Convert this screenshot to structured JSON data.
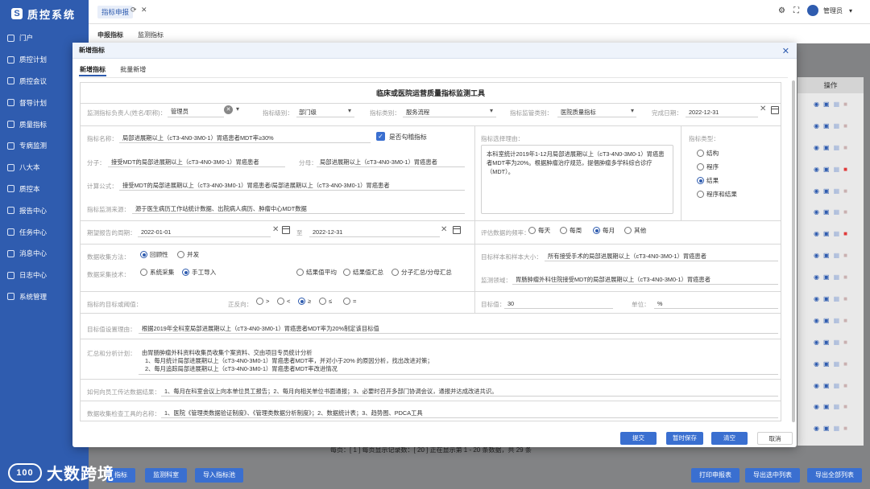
{
  "app": {
    "title": "质控系统"
  },
  "sidebar": {
    "items": [
      {
        "label": "门户"
      },
      {
        "label": "质控计划"
      },
      {
        "label": "质控会议"
      },
      {
        "label": "督导计划"
      },
      {
        "label": "质量指标"
      },
      {
        "label": "专病监测"
      },
      {
        "label": "八大本"
      },
      {
        "label": "质控本"
      },
      {
        "label": "报告中心"
      },
      {
        "label": "任务中心"
      },
      {
        "label": "消息中心"
      },
      {
        "label": "日志中心"
      },
      {
        "label": "系统管理"
      }
    ]
  },
  "header": {
    "tab_label": "指标申报",
    "user_name": "管理员",
    "icons": [
      "refresh-icon",
      "close-icon",
      "settings-icon",
      "fullscreen-icon",
      "avatar-icon",
      "caret-down-icon"
    ]
  },
  "subtabs": {
    "items": [
      {
        "label": "申报指标"
      },
      {
        "label": "监测指标"
      }
    ]
  },
  "background_table": {
    "action_header": "操作",
    "row_count": 16
  },
  "pagination": {
    "text": "每页：[ 1 ] 每页显示记录数：[ 20 ] 正在显示第 1 - 20 条数据，共 29 条"
  },
  "bottom_buttons": {
    "left": [
      "指标",
      "监测科室",
      "导入指标池"
    ],
    "right": [
      "打印申报表",
      "导出选中列表",
      "导出全部列表"
    ]
  },
  "watermark": {
    "text": "大数跨境"
  },
  "modal": {
    "title": "新增指标",
    "tabs": [
      {
        "label": "新增指标"
      },
      {
        "label": "批量新增"
      }
    ],
    "form_title": "临床或医院运营质量指标监测工具",
    "row1": {
      "owner_label": "监测指标负责人(姓名/职称)：",
      "owner_value": "管理员",
      "level_label": "指标级别：",
      "level_value": "部门级",
      "category_label": "指标类别：",
      "category_value": "服务流程",
      "supervise_label": "指标监管类别：",
      "supervise_value": "医院质量指标",
      "date_label": "完成日期：",
      "date_value": "2022-12-31"
    },
    "row2": {
      "name_label": "指标名称：",
      "name_value": "局部进展期以上（cT3-4N0-3M0-1）胃癌患者MDT率≥30%",
      "key_check_label": "是否勾稽指标",
      "reason_label": "指标选择理由：",
      "reason_text": "本科室统计2019年1-12月局部进展期以上（cT3-4N0-3M0-1）胃癌患者MDT率为20%。根据肿瘤治疗规范，提倡肿瘤多学科综合诊疗（MDT）。",
      "type_label": "指标类型：",
      "type_options": [
        {
          "label": "结构",
          "checked": false
        },
        {
          "label": "程序",
          "checked": false
        },
        {
          "label": "结果",
          "checked": true
        },
        {
          "label": "程序和结果",
          "checked": false
        }
      ],
      "numerator_label": "分子：",
      "numerator_value": "接受MDT的局部进展期以上（cT3-4N0-3M0-1）胃癌患者",
      "denominator_label": "分母：",
      "denominator_value": "局部进展期以上（cT3-4N0-3M0-1）胃癌患者",
      "formula_label": "计算公式：",
      "formula_value": "接受MDT的局部进展期以上（cT3-4N0-3M0-1）胃癌患者/局部进展期以上（cT3-4N0-3M0-1）胃癌患者",
      "source_label": "指标监测来源：",
      "source_value": "源于医生病历工作站统计数据、出院病人病历、肿瘤中心MDT数据"
    },
    "row3": {
      "period_label": "期望报告的周期：",
      "start_value": "2022-01-01",
      "to_label": "至",
      "end_value": "2022-12-31",
      "freq_label": "评估数据的频率：",
      "freq_options": [
        {
          "label": "每天",
          "checked": false
        },
        {
          "label": "每周",
          "checked": false
        },
        {
          "label": "每月",
          "checked": true
        },
        {
          "label": "其他",
          "checked": false
        }
      ]
    },
    "row4": {
      "collect_method_label": "数据收集方法：",
      "collect_methods": [
        {
          "label": "回顾性",
          "checked": true
        },
        {
          "label": "并发",
          "checked": false
        }
      ],
      "collect_tech_label": "数据采集技术：",
      "collect_techs": [
        {
          "label": "系统采集",
          "checked": false
        },
        {
          "label": "手工导入",
          "checked": true
        }
      ],
      "agg_options": [
        {
          "label": "结果值平均",
          "checked": false
        },
        {
          "label": "结果值汇总",
          "checked": false
        },
        {
          "label": "分子汇总/分母汇总",
          "checked": false
        }
      ],
      "sample_label": "目标样本和样本大小：",
      "sample_value": "所有接受手术的局部进展期以上（cT3-4N0-3M0-1）胃癌患者",
      "area_label": "监测领域：",
      "area_value": "胃肠肿瘤外科住院接受MDT的局部进展期以上（cT3-4N0-3M0-1）胃癌患者"
    },
    "row5": {
      "goal_label": "指标的目标或阈值：",
      "direction_label": "正反向：",
      "directions": [
        {
          "label": ">",
          "checked": false
        },
        {
          "label": "<",
          "checked": false
        },
        {
          "label": "≥",
          "checked": true
        },
        {
          "label": "≤",
          "checked": false
        },
        {
          "label": "=",
          "checked": false
        }
      ],
      "target_label": "目标值：",
      "target_value": "30",
      "unit_label": "单位：",
      "unit_value": "%"
    },
    "row6": {
      "label": "目标值设置理由：",
      "value": "根据2019年全科室局部进展期以上（cT3-4N0-3M0-1）胃癌患者MDT率为20%制定该目标值"
    },
    "row7": {
      "label": "汇总和分析计划：",
      "lines": [
        "由胃肠肿瘤外科资料收集员收集个案资料、交由项目专员统计分析",
        "1、每月统计局部进展期以上（cT3-4N0-3M0-1）胃癌患者MDT率，并对小于20% 的原因分析，找出改进对策；",
        "2、每月追踪局部进展期以上（cT3-4N0-3M0-1）胃癌患者MDT率改进情况"
      ]
    },
    "row8": {
      "label": "如何向员工传达数据结果：",
      "value": "1、每月在科室会议上向本单位员工报告；2、每月向相关单位书面通报；3、必要时召开多部门协调会议，通报并达成改进共识。"
    },
    "row9": {
      "label": "数据收集检查工具的名称：",
      "value": "1、医院《管理类数据验证制度》、《管理类数据分析制度》；2、数据统计表；3、趋势图、PDCA工具"
    },
    "buttons": {
      "submit": "提交",
      "save": "暂时保存",
      "clear": "清空",
      "cancel": "取消"
    }
  },
  "colors": {
    "primary": "#2f5caf",
    "button": "#3a6fd0",
    "danger": "#e03a3a"
  }
}
